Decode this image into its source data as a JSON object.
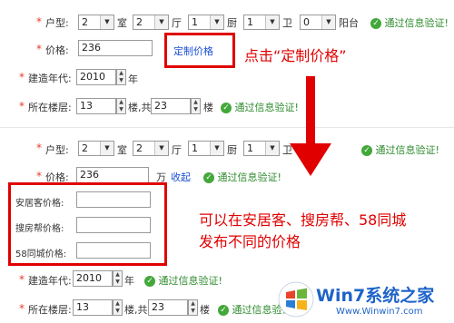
{
  "top": {
    "house_type": {
      "label": "户型:",
      "rooms": "2",
      "room_unit": "室",
      "halls": "2",
      "hall_unit": "厅",
      "kitchens": "1",
      "kitchen_unit": "厨",
      "baths": "1",
      "bath_unit": "卫",
      "balconies": "0",
      "balcony_unit": "阳台",
      "verified": "通过信息验证!"
    },
    "price": {
      "label": "价格:",
      "value": "236",
      "custom_link": "定制价格"
    },
    "year": {
      "label": "建造年代:",
      "value": "2010",
      "unit": "年"
    },
    "floor": {
      "label": "所在楼层:",
      "floor": "13",
      "floor_unit": "楼,共",
      "total": "23",
      "total_unit": "楼",
      "verified": "通过信息验证!"
    }
  },
  "bottom": {
    "house_type": {
      "label": "户型:",
      "rooms": "2",
      "room_unit": "室",
      "halls": "2",
      "hall_unit": "厅",
      "kitchens": "1",
      "kitchen_unit": "厨",
      "baths": "1",
      "bath_unit": "卫",
      "verified": "通过信息验证!"
    },
    "price": {
      "label": "价格:",
      "value": "236",
      "unit": "万",
      "collapse_link": "收起",
      "verified": "通过信息验证!"
    },
    "platforms": [
      {
        "label": "安居客价格:"
      },
      {
        "label": "搜房帮价格:"
      },
      {
        "label": "58同城价格:"
      }
    ],
    "year": {
      "label": "建造年代:",
      "value": "2010",
      "unit": "年",
      "verified": "通过信息验证!"
    },
    "floor": {
      "label": "所在楼层:",
      "floor": "13",
      "floor_unit": "楼,共",
      "total": "23",
      "total_unit": "楼",
      "verified": "通过信息验证!"
    }
  },
  "annotations": {
    "click_hint": "点击“定制价格”",
    "platform_hint_line1": "可以在安居客、搜房帮、58同城",
    "platform_hint_line2": "发布不同的价格"
  },
  "watermark": {
    "brand": "Win7系统之家",
    "url": "Www.Winwin7.com"
  },
  "colors": {
    "highlight": "#e00000",
    "verified": "#43a83a",
    "link": "#1a4fd6"
  }
}
